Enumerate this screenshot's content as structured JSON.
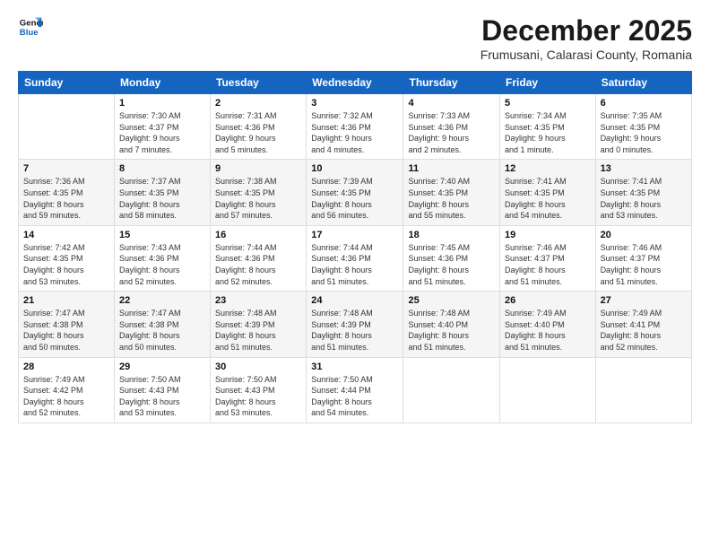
{
  "header": {
    "logo_line1": "General",
    "logo_line2": "Blue",
    "month_title": "December 2025",
    "subtitle": "Frumusani, Calarasi County, Romania"
  },
  "days_of_week": [
    "Sunday",
    "Monday",
    "Tuesday",
    "Wednesday",
    "Thursday",
    "Friday",
    "Saturday"
  ],
  "weeks": [
    [
      {
        "day": "",
        "info": ""
      },
      {
        "day": "1",
        "info": "Sunrise: 7:30 AM\nSunset: 4:37 PM\nDaylight: 9 hours\nand 7 minutes."
      },
      {
        "day": "2",
        "info": "Sunrise: 7:31 AM\nSunset: 4:36 PM\nDaylight: 9 hours\nand 5 minutes."
      },
      {
        "day": "3",
        "info": "Sunrise: 7:32 AM\nSunset: 4:36 PM\nDaylight: 9 hours\nand 4 minutes."
      },
      {
        "day": "4",
        "info": "Sunrise: 7:33 AM\nSunset: 4:36 PM\nDaylight: 9 hours\nand 2 minutes."
      },
      {
        "day": "5",
        "info": "Sunrise: 7:34 AM\nSunset: 4:35 PM\nDaylight: 9 hours\nand 1 minute."
      },
      {
        "day": "6",
        "info": "Sunrise: 7:35 AM\nSunset: 4:35 PM\nDaylight: 9 hours\nand 0 minutes."
      }
    ],
    [
      {
        "day": "7",
        "info": "Sunrise: 7:36 AM\nSunset: 4:35 PM\nDaylight: 8 hours\nand 59 minutes."
      },
      {
        "day": "8",
        "info": "Sunrise: 7:37 AM\nSunset: 4:35 PM\nDaylight: 8 hours\nand 58 minutes."
      },
      {
        "day": "9",
        "info": "Sunrise: 7:38 AM\nSunset: 4:35 PM\nDaylight: 8 hours\nand 57 minutes."
      },
      {
        "day": "10",
        "info": "Sunrise: 7:39 AM\nSunset: 4:35 PM\nDaylight: 8 hours\nand 56 minutes."
      },
      {
        "day": "11",
        "info": "Sunrise: 7:40 AM\nSunset: 4:35 PM\nDaylight: 8 hours\nand 55 minutes."
      },
      {
        "day": "12",
        "info": "Sunrise: 7:41 AM\nSunset: 4:35 PM\nDaylight: 8 hours\nand 54 minutes."
      },
      {
        "day": "13",
        "info": "Sunrise: 7:41 AM\nSunset: 4:35 PM\nDaylight: 8 hours\nand 53 minutes."
      }
    ],
    [
      {
        "day": "14",
        "info": "Sunrise: 7:42 AM\nSunset: 4:35 PM\nDaylight: 8 hours\nand 53 minutes."
      },
      {
        "day": "15",
        "info": "Sunrise: 7:43 AM\nSunset: 4:36 PM\nDaylight: 8 hours\nand 52 minutes."
      },
      {
        "day": "16",
        "info": "Sunrise: 7:44 AM\nSunset: 4:36 PM\nDaylight: 8 hours\nand 52 minutes."
      },
      {
        "day": "17",
        "info": "Sunrise: 7:44 AM\nSunset: 4:36 PM\nDaylight: 8 hours\nand 51 minutes."
      },
      {
        "day": "18",
        "info": "Sunrise: 7:45 AM\nSunset: 4:36 PM\nDaylight: 8 hours\nand 51 minutes."
      },
      {
        "day": "19",
        "info": "Sunrise: 7:46 AM\nSunset: 4:37 PM\nDaylight: 8 hours\nand 51 minutes."
      },
      {
        "day": "20",
        "info": "Sunrise: 7:46 AM\nSunset: 4:37 PM\nDaylight: 8 hours\nand 51 minutes."
      }
    ],
    [
      {
        "day": "21",
        "info": "Sunrise: 7:47 AM\nSunset: 4:38 PM\nDaylight: 8 hours\nand 50 minutes."
      },
      {
        "day": "22",
        "info": "Sunrise: 7:47 AM\nSunset: 4:38 PM\nDaylight: 8 hours\nand 50 minutes."
      },
      {
        "day": "23",
        "info": "Sunrise: 7:48 AM\nSunset: 4:39 PM\nDaylight: 8 hours\nand 51 minutes."
      },
      {
        "day": "24",
        "info": "Sunrise: 7:48 AM\nSunset: 4:39 PM\nDaylight: 8 hours\nand 51 minutes."
      },
      {
        "day": "25",
        "info": "Sunrise: 7:48 AM\nSunset: 4:40 PM\nDaylight: 8 hours\nand 51 minutes."
      },
      {
        "day": "26",
        "info": "Sunrise: 7:49 AM\nSunset: 4:40 PM\nDaylight: 8 hours\nand 51 minutes."
      },
      {
        "day": "27",
        "info": "Sunrise: 7:49 AM\nSunset: 4:41 PM\nDaylight: 8 hours\nand 52 minutes."
      }
    ],
    [
      {
        "day": "28",
        "info": "Sunrise: 7:49 AM\nSunset: 4:42 PM\nDaylight: 8 hours\nand 52 minutes."
      },
      {
        "day": "29",
        "info": "Sunrise: 7:50 AM\nSunset: 4:43 PM\nDaylight: 8 hours\nand 53 minutes."
      },
      {
        "day": "30",
        "info": "Sunrise: 7:50 AM\nSunset: 4:43 PM\nDaylight: 8 hours\nand 53 minutes."
      },
      {
        "day": "31",
        "info": "Sunrise: 7:50 AM\nSunset: 4:44 PM\nDaylight: 8 hours\nand 54 minutes."
      },
      {
        "day": "",
        "info": ""
      },
      {
        "day": "",
        "info": ""
      },
      {
        "day": "",
        "info": ""
      }
    ]
  ]
}
